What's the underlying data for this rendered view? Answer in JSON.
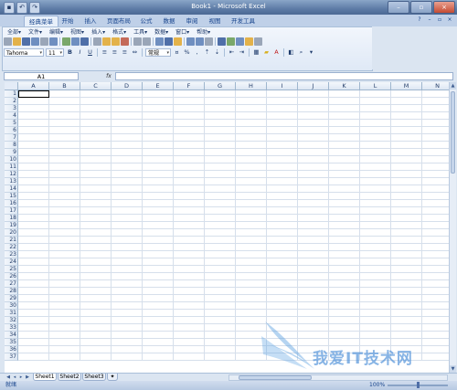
{
  "window": {
    "title": "Book1 - Microsoft Excel"
  },
  "qat": {
    "icons": [
      "save-icon",
      "undo-icon",
      "redo-icon"
    ]
  },
  "tabs": [
    {
      "label": "经典菜单",
      "active": true
    },
    {
      "label": "开始"
    },
    {
      "label": "插入"
    },
    {
      "label": "页面布局"
    },
    {
      "label": "公式"
    },
    {
      "label": "数据"
    },
    {
      "label": "审阅"
    },
    {
      "label": "视图"
    },
    {
      "label": "开发工具"
    }
  ],
  "menus": [
    "全部▾",
    "文件▾",
    "编辑▾",
    "视图▾",
    "插入▾",
    "格式▾",
    "工具▾",
    "数据▾",
    "窗口▾",
    "帮助▾"
  ],
  "toolbar": {
    "font_name": "Tahoma",
    "font_size": "11",
    "bold": "B",
    "italic": "I",
    "underline": "U",
    "number_format": "常规",
    "percent": "%",
    "comma": ","
  },
  "formula_bar": {
    "name_box": "A1",
    "fx": "fx",
    "content": ""
  },
  "grid": {
    "columns": [
      "A",
      "B",
      "C",
      "D",
      "E",
      "F",
      "G",
      "H",
      "I",
      "J",
      "K",
      "L",
      "M",
      "N"
    ],
    "rows": [
      1,
      2,
      3,
      4,
      5,
      6,
      7,
      8,
      9,
      10,
      11,
      12,
      13,
      14,
      15,
      16,
      17,
      18,
      19,
      20,
      21,
      22,
      23,
      24,
      25,
      26,
      27,
      28,
      29,
      30,
      31,
      32,
      33,
      34,
      35,
      36,
      37
    ]
  },
  "sheets": [
    {
      "label": "Sheet1",
      "active": true
    },
    {
      "label": "Sheet2"
    },
    {
      "label": "Sheet3"
    }
  ],
  "status": {
    "ready": "就绪",
    "zoom": "100%",
    "zoom_level": 0.5
  },
  "watermark": {
    "text": "我爱IT技术网"
  },
  "colors": {
    "accent": "#15428b",
    "grid_line": "#d6dfeb",
    "header_bg": "#dde7f3"
  }
}
